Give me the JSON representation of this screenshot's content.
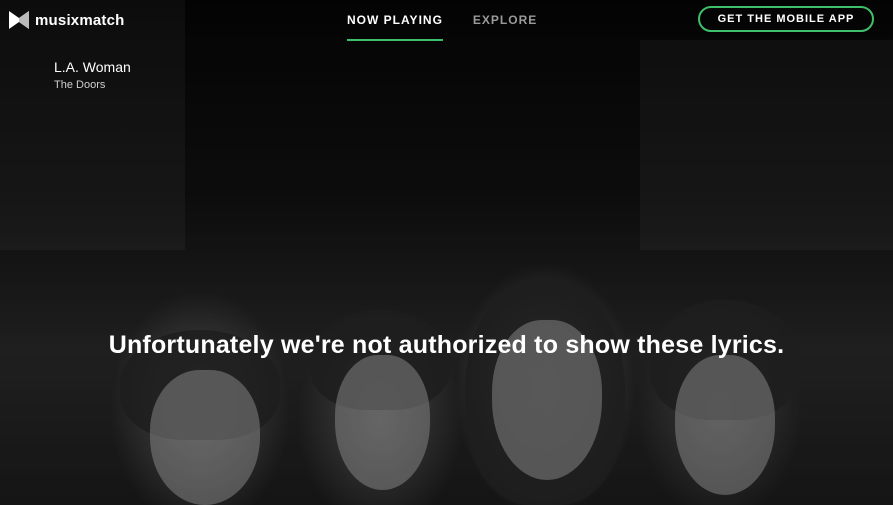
{
  "brand": {
    "name": "musixmatch",
    "icon": "musixmatch-logo-icon"
  },
  "nav": {
    "tabs": [
      {
        "label": "NOW PLAYING",
        "active": true
      },
      {
        "label": "EXPLORE",
        "active": false
      }
    ]
  },
  "cta": {
    "label": "GET THE MOBILE APP"
  },
  "track": {
    "title": "L.A. Woman",
    "artist": "The Doors"
  },
  "message": "Unfortunately we're not authorized to show these lyrics.",
  "colors": {
    "accent": "#3fbf6a",
    "background": "#0b0b0b"
  }
}
